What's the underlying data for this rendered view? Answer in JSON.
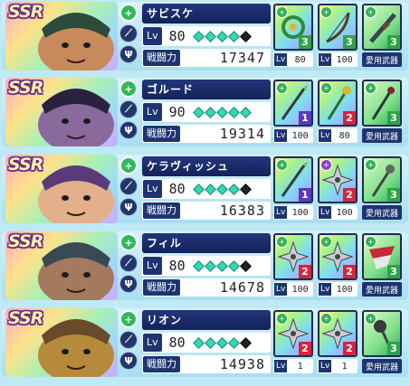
{
  "characters": [
    {
      "rarity": "SSR",
      "name": "サビスケ",
      "level_label": "Lv",
      "level": "80",
      "stars_filled": 4,
      "stars_total": 5,
      "bp_label": "戦闘力",
      "battle_power": "17347",
      "weapons": [
        {
          "rank": "3",
          "level_label": "Lv",
          "level": "80",
          "type": "plus"
        },
        {
          "rank": "3",
          "level_label": "Lv",
          "level": "100",
          "type": "plus"
        },
        {
          "rank": "3",
          "label": "愛用武器",
          "type": "plus"
        }
      ]
    },
    {
      "rarity": "SSR",
      "name": "ゴルード",
      "level_label": "Lv",
      "level": "90",
      "stars_filled": 5,
      "stars_total": 5,
      "bp_label": "戦闘力",
      "battle_power": "19314",
      "weapons": [
        {
          "rank": "1",
          "level_label": "Lv",
          "level": "100",
          "type": "plus"
        },
        {
          "rank": "2",
          "level_label": "Lv",
          "level": "80",
          "type": "plus"
        },
        {
          "rank": "3",
          "label": "愛用武器",
          "type": "plus"
        }
      ]
    },
    {
      "rarity": "SSR",
      "name": "ケラヴィッシュ",
      "level_label": "Lv",
      "level": "80",
      "stars_filled": 4,
      "stars_total": 5,
      "bp_label": "戦闘力",
      "battle_power": "16383",
      "weapons": [
        {
          "rank": "1",
          "level_label": "Lv",
          "level": "100",
          "type": "plus"
        },
        {
          "rank": "2",
          "level_label": "Lv",
          "level": "100",
          "type": "purple"
        },
        {
          "rank": "3",
          "label": "愛用武器",
          "type": "plus"
        }
      ]
    },
    {
      "rarity": "SSR",
      "name": "フィル",
      "level_label": "Lv",
      "level": "80",
      "stars_filled": 4,
      "stars_total": 5,
      "bp_label": "戦闘力",
      "battle_power": "14678",
      "weapons": [
        {
          "rank": "2",
          "level_label": "Lv",
          "level": "100",
          "type": "plus"
        },
        {
          "rank": "2",
          "level_label": "Lv",
          "level": "100",
          "type": "plus"
        },
        {
          "rank": "3",
          "label": "愛用武器",
          "type": "plus"
        }
      ]
    },
    {
      "rarity": "SSR",
      "name": "リオン",
      "level_label": "Lv",
      "level": "80",
      "stars_filled": 4,
      "stars_total": 5,
      "bp_label": "戦闘力",
      "battle_power": "14938",
      "weapons": [
        {
          "rank": "2",
          "level_label": "Lv",
          "level": "1",
          "type": "plus"
        },
        {
          "rank": "2",
          "level_label": "Lv",
          "level": "1",
          "type": "plus"
        },
        {
          "rank": "3",
          "label": "愛用武器",
          "type": "plus"
        }
      ]
    }
  ],
  "colors": {
    "background": "#bfe9f5",
    "name_bar": "#22367a",
    "star_filled": "#34d7b4",
    "rank_1": "#5b39b9",
    "rank_2": "#d8253a",
    "rank_3": "#2ea446"
  },
  "icons": {
    "side_icon_1": "plus-circle-icon",
    "side_icon_2": "weapon-type-icon",
    "side_icon_3": "trident-icon"
  }
}
